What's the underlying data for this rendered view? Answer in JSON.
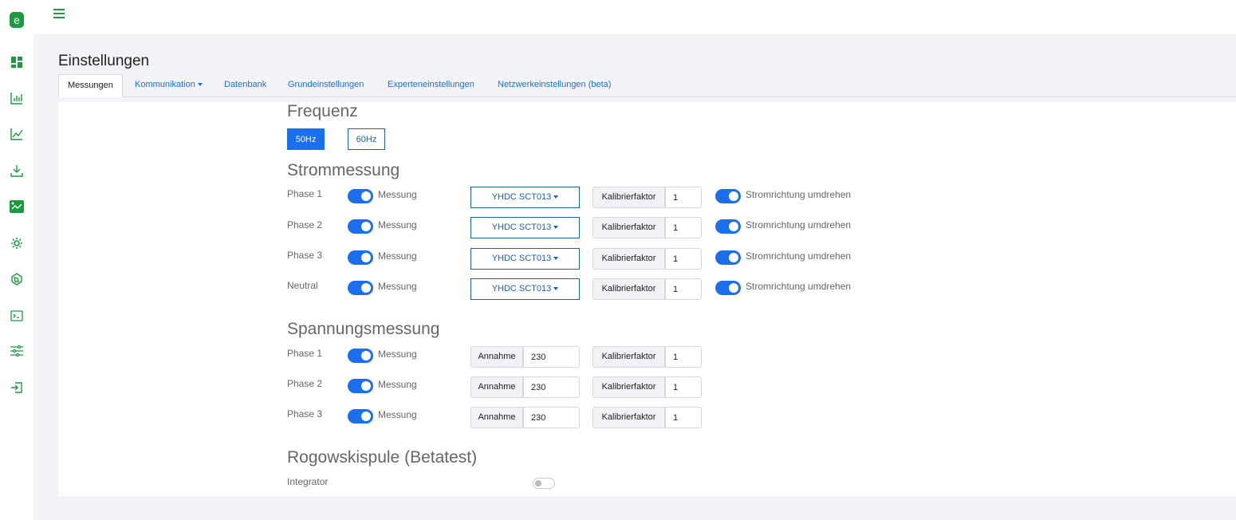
{
  "app": {
    "logo_letter": "e",
    "accent": "#1c9a3f",
    "primary": "#1b6fee"
  },
  "sidebar": {
    "icons": [
      "dashboard-icon",
      "bar-chart-icon",
      "line-chart-icon",
      "download-icon",
      "energy-flow-icon",
      "settings-gear-icon",
      "network-icon",
      "terminal-icon",
      "sliders-icon",
      "logout-icon"
    ]
  },
  "page": {
    "title": "Einstellungen"
  },
  "tabs": [
    {
      "label": "Messungen",
      "active": true
    },
    {
      "label": "Kommunikation",
      "dropdown": true
    },
    {
      "label": "Datenbank"
    },
    {
      "label": "Grundeinstellungen"
    },
    {
      "label": "Experteneinstellungen"
    },
    {
      "label": "Netzwerkeinstellungen (beta)"
    }
  ],
  "frequency": {
    "heading": "Frequenz",
    "options": [
      "50Hz",
      "60Hz"
    ],
    "selected": "50Hz"
  },
  "current": {
    "heading": "Strommessung",
    "rows": [
      {
        "label": "Phase 1",
        "switch_label": "Messung",
        "enabled": true,
        "sensor": "YHDC SCT013",
        "cal_label": "Kalibrierfaktor",
        "cal_value": "1",
        "invert_label": "Stromrichtung umdrehen",
        "invert": true
      },
      {
        "label": "Phase 2",
        "switch_label": "Messung",
        "enabled": true,
        "sensor": "YHDC SCT013",
        "cal_label": "Kalibrierfaktor",
        "cal_value": "1",
        "invert_label": "Stromrichtung umdrehen",
        "invert": true
      },
      {
        "label": "Phase 3",
        "switch_label": "Messung",
        "enabled": true,
        "sensor": "YHDC SCT013",
        "cal_label": "Kalibrierfaktor",
        "cal_value": "1",
        "invert_label": "Stromrichtung umdrehen",
        "invert": true
      },
      {
        "label": "Neutral",
        "switch_label": "Messung",
        "enabled": true,
        "sensor": "YHDC SCT013",
        "cal_label": "Kalibrierfaktor",
        "cal_value": "1",
        "invert_label": "Stromrichtung umdrehen",
        "invert": true
      }
    ]
  },
  "voltage": {
    "heading": "Spannungsmessung",
    "rows": [
      {
        "label": "Phase 1",
        "switch_label": "Messung",
        "enabled": true,
        "assume_label": "Annahme",
        "assume_value": "230",
        "cal_label": "Kalibrierfaktor",
        "cal_value": "1"
      },
      {
        "label": "Phase 2",
        "switch_label": "Messung",
        "enabled": true,
        "assume_label": "Annahme",
        "assume_value": "230",
        "cal_label": "Kalibrierfaktor",
        "cal_value": "1"
      },
      {
        "label": "Phase 3",
        "switch_label": "Messung",
        "enabled": true,
        "assume_label": "Annahme",
        "assume_value": "230",
        "cal_label": "Kalibrierfaktor",
        "cal_value": "1"
      }
    ]
  },
  "rogowski": {
    "heading": "Rogowskispule (Betatest)",
    "integrator_label": "Integrator",
    "integrator": false
  }
}
